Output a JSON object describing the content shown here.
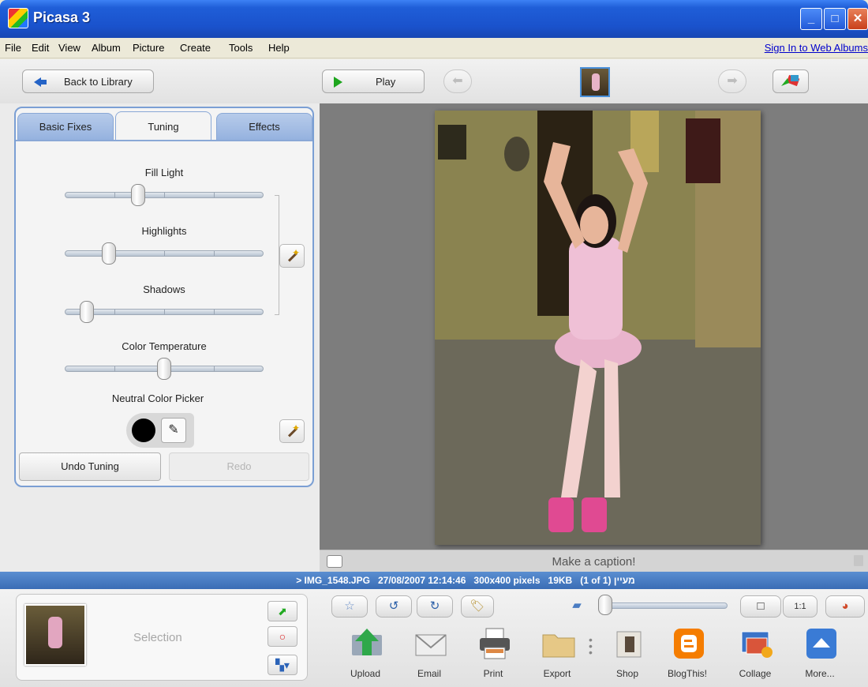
{
  "window": {
    "title": "Picasa 3",
    "controls": [
      "_",
      "□",
      "✕"
    ]
  },
  "menu": {
    "items": [
      "File",
      "Edit",
      "View",
      "Album",
      "Picture",
      "Create",
      "Tools",
      "Help"
    ],
    "sign_in": "Sign In to Web Albums"
  },
  "toolbar": {
    "back_label": "Back to Library",
    "play_label": "Play"
  },
  "edit_panel": {
    "tabs": [
      "Basic Fixes",
      "Tuning",
      "Effects"
    ],
    "active_tab": "Tuning",
    "sliders": [
      {
        "label": "Fill Light",
        "value": 0.36
      },
      {
        "label": "Highlights",
        "value": 0.2
      },
      {
        "label": "Shadows",
        "value": 0.08
      },
      {
        "label": "Color Temperature",
        "value": 0.5
      }
    ],
    "neutral_picker_label": "Neutral Color Picker",
    "undo_label": "Undo Tuning",
    "redo_label": "Redo"
  },
  "viewer": {
    "caption_placeholder": "Make a caption!"
  },
  "status": {
    "filename": "> IMG_1548.JPG",
    "datetime": "27/08/2007 12:14:46",
    "dimensions": "300x400 pixels",
    "size": "19KB",
    "position": "(1 of 1) מעיין"
  },
  "tray": {
    "selection_label": "Selection"
  },
  "zoom": {
    "value": 0.03,
    "fit_label": "□",
    "actual_label": "1:1"
  },
  "actions": [
    "Upload",
    "Email",
    "Print",
    "Export",
    "Shop",
    "BlogThis!",
    "Collage",
    "More..."
  ],
  "colors": {
    "title_blue": "#1f5ed8",
    "status_blue": "#3a6db5",
    "tab_blue": "#95b2df",
    "blogger_orange": "#f57d00",
    "more_blue": "#3a7bd5"
  }
}
